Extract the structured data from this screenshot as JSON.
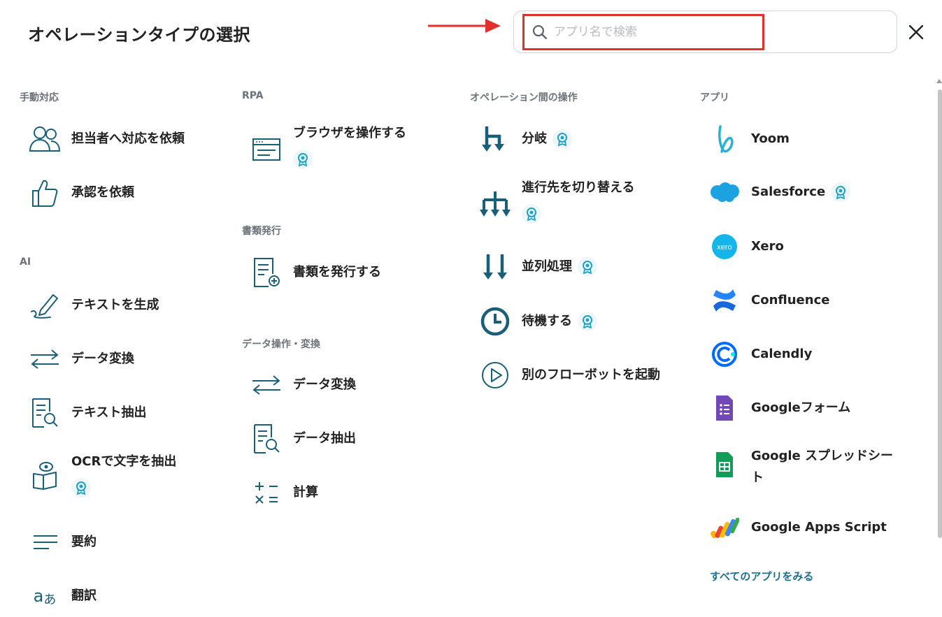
{
  "title": "オペレーションタイプの選択",
  "search": {
    "placeholder": "アプリ名で検索"
  },
  "colors": {
    "accent": "#1a5f7a",
    "badge": "#1ba3c6",
    "highlight": "#e0322a"
  },
  "sections": {
    "manual": {
      "heading": "手動対応",
      "items": [
        {
          "label": "担当者へ対応を依頼",
          "icon": "people-icon"
        },
        {
          "label": "承認を依頼",
          "icon": "thumbs-up-icon"
        }
      ]
    },
    "ai": {
      "heading": "AI",
      "items": [
        {
          "label": "テキストを生成",
          "icon": "pen-icon"
        },
        {
          "label": "データ変換",
          "icon": "swap-arrows-icon"
        },
        {
          "label": "テキスト抽出",
          "icon": "document-search-icon"
        },
        {
          "label": "OCRで文字を抽出",
          "icon": "book-eye-icon",
          "premium": true
        },
        {
          "label": "要約",
          "icon": "lines-icon"
        },
        {
          "label": "翻訳",
          "icon": "translate-icon"
        }
      ]
    },
    "rpa": {
      "heading": "RPA",
      "items": [
        {
          "label": "ブラウザを操作する",
          "icon": "browser-icon",
          "premium": true
        }
      ]
    },
    "docs": {
      "heading": "書類発行",
      "items": [
        {
          "label": "書類を発行する",
          "icon": "document-add-icon"
        }
      ]
    },
    "data": {
      "heading": "データ操作・変換",
      "items": [
        {
          "label": "データ変換",
          "icon": "swap-arrows-icon"
        },
        {
          "label": "データ抽出",
          "icon": "document-search-icon"
        },
        {
          "label": "計算",
          "icon": "calculator-icon"
        }
      ]
    },
    "ops": {
      "heading": "オペレーション間の操作",
      "items": [
        {
          "label": "分岐",
          "icon": "branch-icon",
          "premium": true
        },
        {
          "label": "進行先を切り替える",
          "icon": "switch-icon",
          "premium": true
        },
        {
          "label": "並列処理",
          "icon": "parallel-icon",
          "premium": true
        },
        {
          "label": "待機する",
          "icon": "clock-icon",
          "premium": true
        },
        {
          "label": "別のフローボットを起動",
          "icon": "play-icon"
        }
      ]
    },
    "apps": {
      "heading": "アプリ",
      "items": [
        {
          "label": "Yoom",
          "icon": "yoom-logo-icon"
        },
        {
          "label": "Salesforce",
          "icon": "salesforce-logo-icon",
          "premium": true
        },
        {
          "label": "Xero",
          "icon": "xero-logo-icon"
        },
        {
          "label": "Confluence",
          "icon": "confluence-logo-icon"
        },
        {
          "label": "Calendly",
          "icon": "calendly-logo-icon"
        },
        {
          "label": "Googleフォーム",
          "icon": "google-forms-icon"
        },
        {
          "label": "Google スプレッドシート",
          "icon": "google-sheets-icon"
        },
        {
          "label": "Google Apps Script",
          "icon": "google-apps-script-icon"
        }
      ],
      "all_link": "すべてのアプリをみる"
    }
  },
  "xero_text": "xero"
}
